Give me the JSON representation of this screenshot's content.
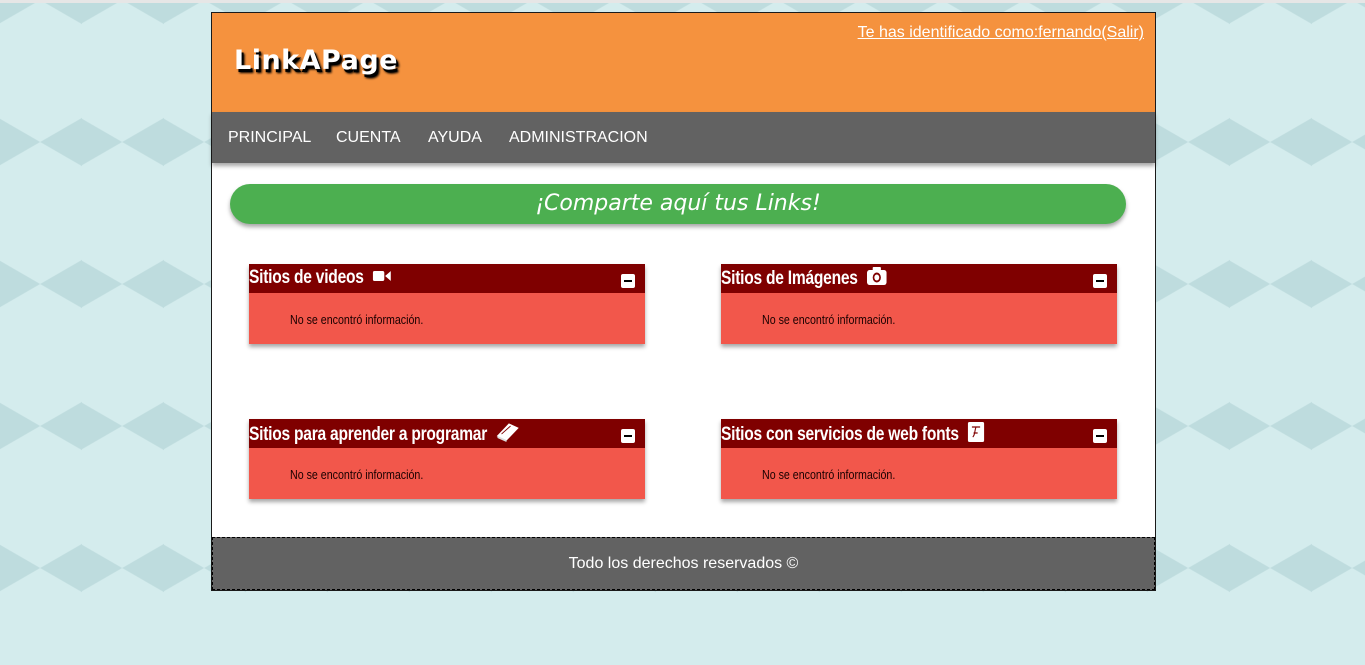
{
  "app": {
    "logo": "LinkAPage",
    "user_link": "Te has identificado como:fernando(Salir)"
  },
  "nav": {
    "items": [
      {
        "label": "PRINCIPAL"
      },
      {
        "label": "CUENTA"
      },
      {
        "label": "AYUDA"
      },
      {
        "label": "ADMINISTRACION"
      }
    ]
  },
  "banner": {
    "text": "¡Comparte aquí tus Links!"
  },
  "panels": [
    {
      "title": "Sitios de videos",
      "icon": "video-camera-icon",
      "message": "No se encontró información."
    },
    {
      "title": "Sitios de Imágenes",
      "icon": "camera-icon",
      "message": "No se encontró información."
    },
    {
      "title": "Sitios para aprender a programar",
      "icon": "book-icon",
      "message": "No se encontró información."
    },
    {
      "title": "Sitios con servicios de web fonts",
      "icon": "font-icon",
      "message": "No se encontró información."
    }
  ],
  "footer": {
    "text": "Todo los derechos reservados ©"
  },
  "colors": {
    "header": "#f5923e",
    "nav": "#626262",
    "banner": "#4caf50",
    "panel_head": "#7f0000",
    "panel_body": "#f2574b",
    "background": "#d4eced"
  }
}
